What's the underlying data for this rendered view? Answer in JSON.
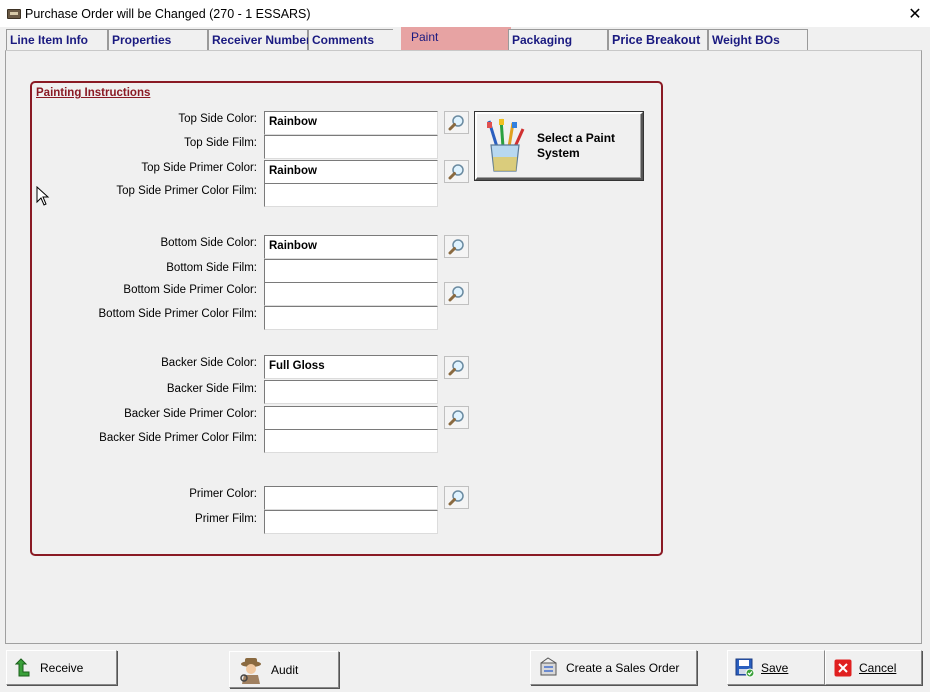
{
  "window": {
    "title": "Purchase Order will be Changed  (270 - 1  ESSARS)",
    "close_glyph": "✕"
  },
  "tabs": [
    {
      "label": "Line Item Info"
    },
    {
      "label": "Properties"
    },
    {
      "label": "Receiver Numbers"
    },
    {
      "label": "Comments"
    },
    {
      "label": "Paint",
      "active": true
    },
    {
      "label": "Packaging"
    },
    {
      "label": "Price Breakout"
    },
    {
      "label": "Weight BOs"
    }
  ],
  "painting": {
    "group_title": "Painting Instructions",
    "fields": [
      {
        "label": "Top Side Color:",
        "value": "Rainbow"
      },
      {
        "label": "Top Side Film:",
        "value": ""
      },
      {
        "label": "Top Side Primer Color:",
        "value": "Rainbow"
      },
      {
        "label": "Top Side Primer Color Film:",
        "value": ""
      },
      {
        "label": "Bottom Side Color:",
        "value": "Rainbow"
      },
      {
        "label": "Bottom Side Film:",
        "value": ""
      },
      {
        "label": "Bottom Side Primer Color:",
        "value": ""
      },
      {
        "label": "Bottom Side Primer Color Film:",
        "value": ""
      },
      {
        "label": "Backer Side Color:",
        "value": "Full Gloss"
      },
      {
        "label": "Backer Side Film:",
        "value": ""
      },
      {
        "label": "Backer Side Primer Color:",
        "value": ""
      },
      {
        "label": "Backer Side Primer Color Film:",
        "value": ""
      },
      {
        "label": "Primer Color:",
        "value": ""
      },
      {
        "label": "Primer Film:",
        "value": ""
      }
    ],
    "select_paint_button": "Select a Paint System"
  },
  "footer": {
    "receive": "Receive",
    "audit": "Audit",
    "create_sales_order": "Create a Sales Order",
    "save": "Save",
    "cancel": "Cancel"
  },
  "colors": {
    "active_tab": "#e7a3a3",
    "group_border": "#8a1a24",
    "tab_text": "#1a1a80"
  }
}
